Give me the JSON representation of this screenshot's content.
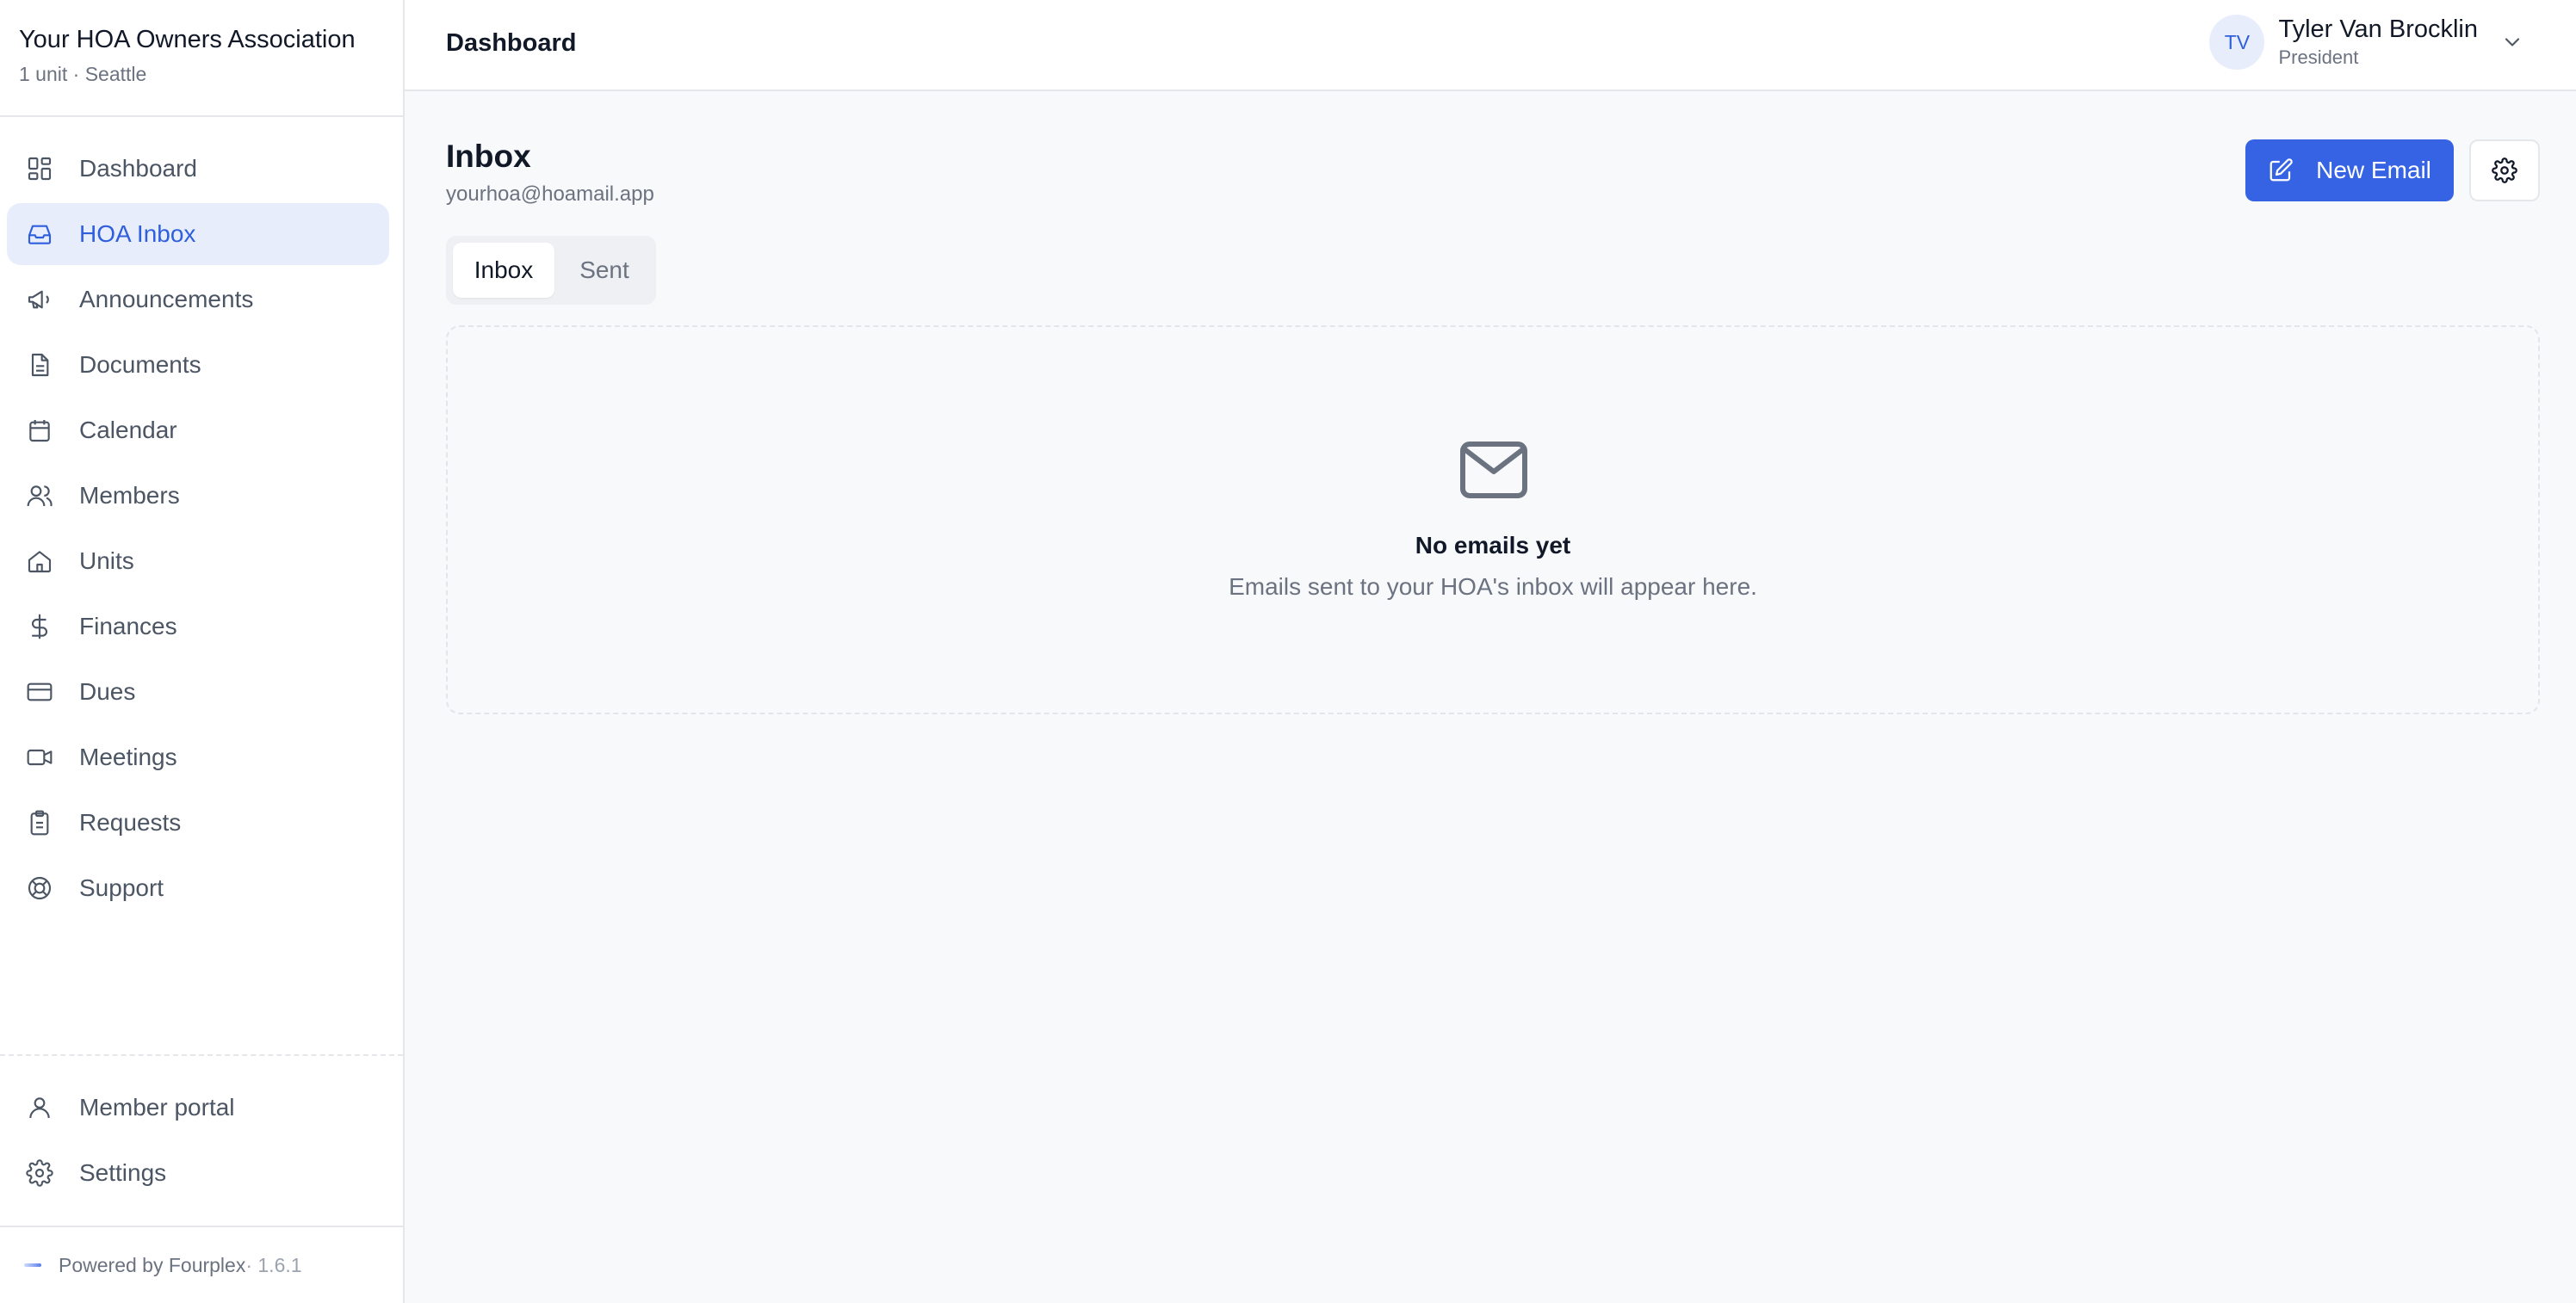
{
  "org": {
    "name": "Your HOA Owners Association",
    "subtitle": "1 unit · Seattle"
  },
  "sidebar": {
    "items": [
      {
        "label": "Dashboard",
        "icon": "dashboard-icon"
      },
      {
        "label": "HOA Inbox",
        "icon": "inbox-icon",
        "active": true
      },
      {
        "label": "Announcements",
        "icon": "megaphone-icon"
      },
      {
        "label": "Documents",
        "icon": "document-icon"
      },
      {
        "label": "Calendar",
        "icon": "calendar-icon"
      },
      {
        "label": "Members",
        "icon": "members-icon"
      },
      {
        "label": "Units",
        "icon": "home-icon"
      },
      {
        "label": "Finances",
        "icon": "dollar-icon"
      },
      {
        "label": "Dues",
        "icon": "credit-card-icon"
      },
      {
        "label": "Meetings",
        "icon": "video-icon"
      },
      {
        "label": "Requests",
        "icon": "clipboard-icon"
      },
      {
        "label": "Support",
        "icon": "lifebuoy-icon"
      }
    ],
    "bottom_items": [
      {
        "label": "Member portal",
        "icon": "user-icon"
      },
      {
        "label": "Settings",
        "icon": "gear-icon"
      }
    ],
    "footer": {
      "text": "Powered by Fourplex",
      "version": " · 1.6.1"
    }
  },
  "topbar": {
    "breadcrumb": "Dashboard",
    "user": {
      "initials": "TV",
      "name": "Tyler Van Brocklin",
      "role": "President"
    }
  },
  "main": {
    "title": "Inbox",
    "email": "yourhoa@hoamail.app",
    "new_email_label": "New Email",
    "tabs": [
      {
        "label": "Inbox",
        "active": true
      },
      {
        "label": "Sent",
        "active": false
      }
    ],
    "empty": {
      "title": "No emails yet",
      "description": "Emails sent to your HOA's inbox will appear here."
    }
  },
  "colors": {
    "accent": "#3563e3",
    "active_bg": "#e8edfc",
    "active_text": "#2f5fdd",
    "text_muted": "#6b7280",
    "border": "#e5e7eb"
  }
}
